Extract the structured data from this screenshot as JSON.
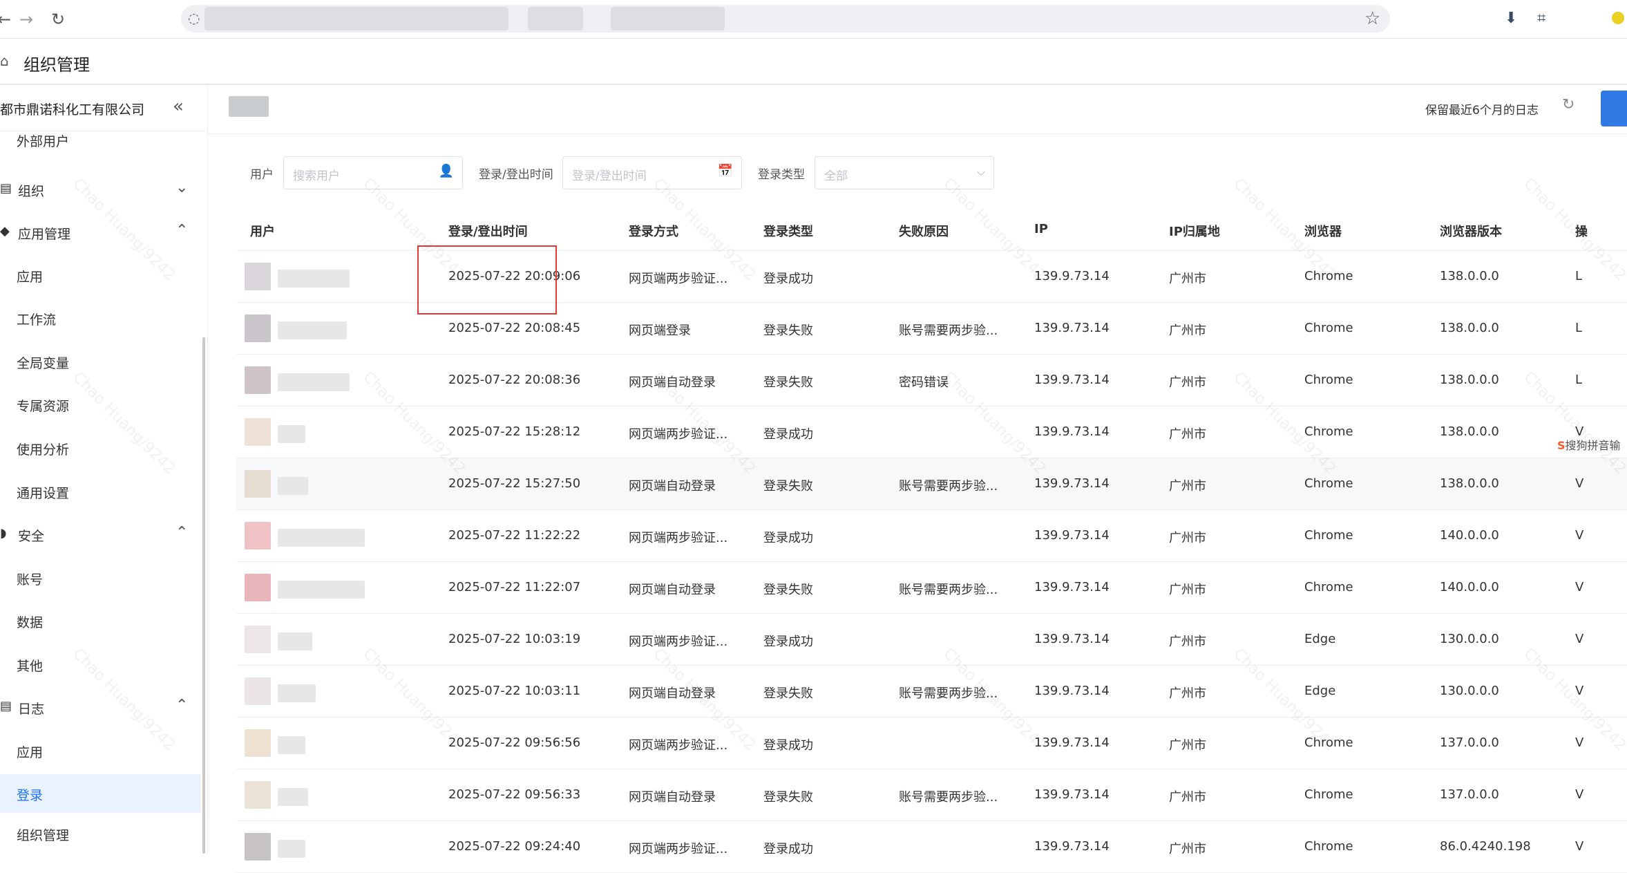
{
  "browser": {
    "back": "←",
    "forward": "→",
    "reload": "↻"
  },
  "header": {
    "title": "组织管理"
  },
  "sidebar": {
    "org_name": "都市鼎诺科化工有限公司",
    "items": [
      {
        "label": "外部用户",
        "type": "item"
      },
      {
        "label": "组织",
        "type": "group",
        "icon": "org-icon",
        "expanded": false
      },
      {
        "label": "应用管理",
        "type": "group",
        "icon": "apps-icon",
        "expanded": true
      },
      {
        "label": "应用",
        "type": "item"
      },
      {
        "label": "工作流",
        "type": "item"
      },
      {
        "label": "全局变量",
        "type": "item"
      },
      {
        "label": "专属资源",
        "type": "item"
      },
      {
        "label": "使用分析",
        "type": "item"
      },
      {
        "label": "通用设置",
        "type": "item"
      },
      {
        "label": "安全",
        "type": "group",
        "icon": "shield-icon",
        "expanded": true
      },
      {
        "label": "账号",
        "type": "item"
      },
      {
        "label": "数据",
        "type": "item"
      },
      {
        "label": "其他",
        "type": "item"
      },
      {
        "label": "日志",
        "type": "group",
        "icon": "log-icon",
        "expanded": true
      },
      {
        "label": "应用",
        "type": "item"
      },
      {
        "label": "登录",
        "type": "item",
        "active": true
      },
      {
        "label": "组织管理",
        "type": "item"
      }
    ]
  },
  "toolbar": {
    "retention_text": "保留最近6个月的日志"
  },
  "filters": {
    "user_label": "用户",
    "user_placeholder": "搜索用户",
    "time_label": "登录/登出时间",
    "time_placeholder": "登录/登出时间",
    "type_label": "登录类型",
    "type_value": "全部"
  },
  "table": {
    "columns": [
      "用户",
      "登录/登出时间",
      "登录方式",
      "登录类型",
      "失败原因",
      "IP",
      "IP归属地",
      "浏览器",
      "浏览器版本",
      "操"
    ],
    "rows": [
      {
        "time": "2025-07-22 20:09:06",
        "method": "网页端两步验证...",
        "type": "登录成功",
        "reason": "",
        "ip": "139.9.73.14",
        "loc": "广州市",
        "browser": "Chrome",
        "version": "138.0.0.0",
        "os": "L",
        "avatar_color": "#d9d5da"
      },
      {
        "time": "2025-07-22 20:08:45",
        "method": "网页端登录",
        "type": "登录失败",
        "reason": "账号需要两步验...",
        "ip": "139.9.73.14",
        "loc": "广州市",
        "browser": "Chrome",
        "version": "138.0.0.0",
        "os": "L",
        "avatar_color": "#cbc6cb"
      },
      {
        "time": "2025-07-22 20:08:36",
        "method": "网页端自动登录",
        "type": "登录失败",
        "reason": "密码错误",
        "ip": "139.9.73.14",
        "loc": "广州市",
        "browser": "Chrome",
        "version": "138.0.0.0",
        "os": "L",
        "avatar_color": "#cfc3ca"
      },
      {
        "time": "2025-07-22 15:28:12",
        "method": "网页端两步验证...",
        "type": "登录成功",
        "reason": "",
        "ip": "139.9.73.14",
        "loc": "广州市",
        "browser": "Chrome",
        "version": "138.0.0.0",
        "os": "V",
        "avatar_color": "#ede2d5"
      },
      {
        "time": "2025-07-22 15:27:50",
        "method": "网页端自动登录",
        "type": "登录失败",
        "reason": "账号需要两步验...",
        "ip": "139.9.73.14",
        "loc": "广州市",
        "browser": "Chrome",
        "version": "138.0.0.0",
        "os": "V",
        "avatar_color": "#e6ddd2"
      },
      {
        "time": "2025-07-22 11:22:22",
        "method": "网页端两步验证...",
        "type": "登录成功",
        "reason": "",
        "ip": "139.9.73.14",
        "loc": "广州市",
        "browser": "Chrome",
        "version": "140.0.0.0",
        "os": "V",
        "avatar_color": "#efc2c6"
      },
      {
        "time": "2025-07-22 11:22:07",
        "method": "网页端自动登录",
        "type": "登录失败",
        "reason": "账号需要两步验...",
        "ip": "139.9.73.14",
        "loc": "广州市",
        "browser": "Chrome",
        "version": "140.0.0.0",
        "os": "V",
        "avatar_color": "#e8b5ba"
      },
      {
        "time": "2025-07-22 10:03:19",
        "method": "网页端两步验证...",
        "type": "登录成功",
        "reason": "",
        "ip": "139.9.73.14",
        "loc": "广州市",
        "browser": "Edge",
        "version": "130.0.0.0",
        "os": "V",
        "avatar_color": "#ece6e6"
      },
      {
        "time": "2025-07-22 10:03:11",
        "method": "网页端自动登录",
        "type": "登录失败",
        "reason": "账号需要两步验...",
        "ip": "139.9.73.14",
        "loc": "广州市",
        "browser": "Edge",
        "version": "130.0.0.0",
        "os": "V",
        "avatar_color": "#ebe5e5"
      },
      {
        "time": "2025-07-22 09:56:56",
        "method": "网页端两步验证...",
        "type": "登录成功",
        "reason": "",
        "ip": "139.9.73.14",
        "loc": "广州市",
        "browser": "Chrome",
        "version": "137.0.0.0",
        "os": "V",
        "avatar_color": "#efe1d2"
      },
      {
        "time": "2025-07-22 09:56:33",
        "method": "网页端自动登录",
        "type": "登录失败",
        "reason": "账号需要两步验...",
        "ip": "139.9.73.14",
        "loc": "广州市",
        "browser": "Chrome",
        "version": "137.0.0.0",
        "os": "V",
        "avatar_color": "#ece3d6"
      },
      {
        "time": "2025-07-22 09:24:40",
        "method": "网页端两步验证...",
        "type": "登录成功",
        "reason": "",
        "ip": "139.9.73.14",
        "loc": "广州市",
        "browser": "Chrome",
        "version": "86.0.4240.198",
        "os": "V",
        "avatar_color": "#c8c3c3"
      }
    ]
  },
  "overlay": {
    "ime_text": "搜狗拼音输",
    "watermark_text": "Chao Huang/9242"
  },
  "colors": {
    "accent": "#1e6fff",
    "highlight_box": "#e53935"
  }
}
